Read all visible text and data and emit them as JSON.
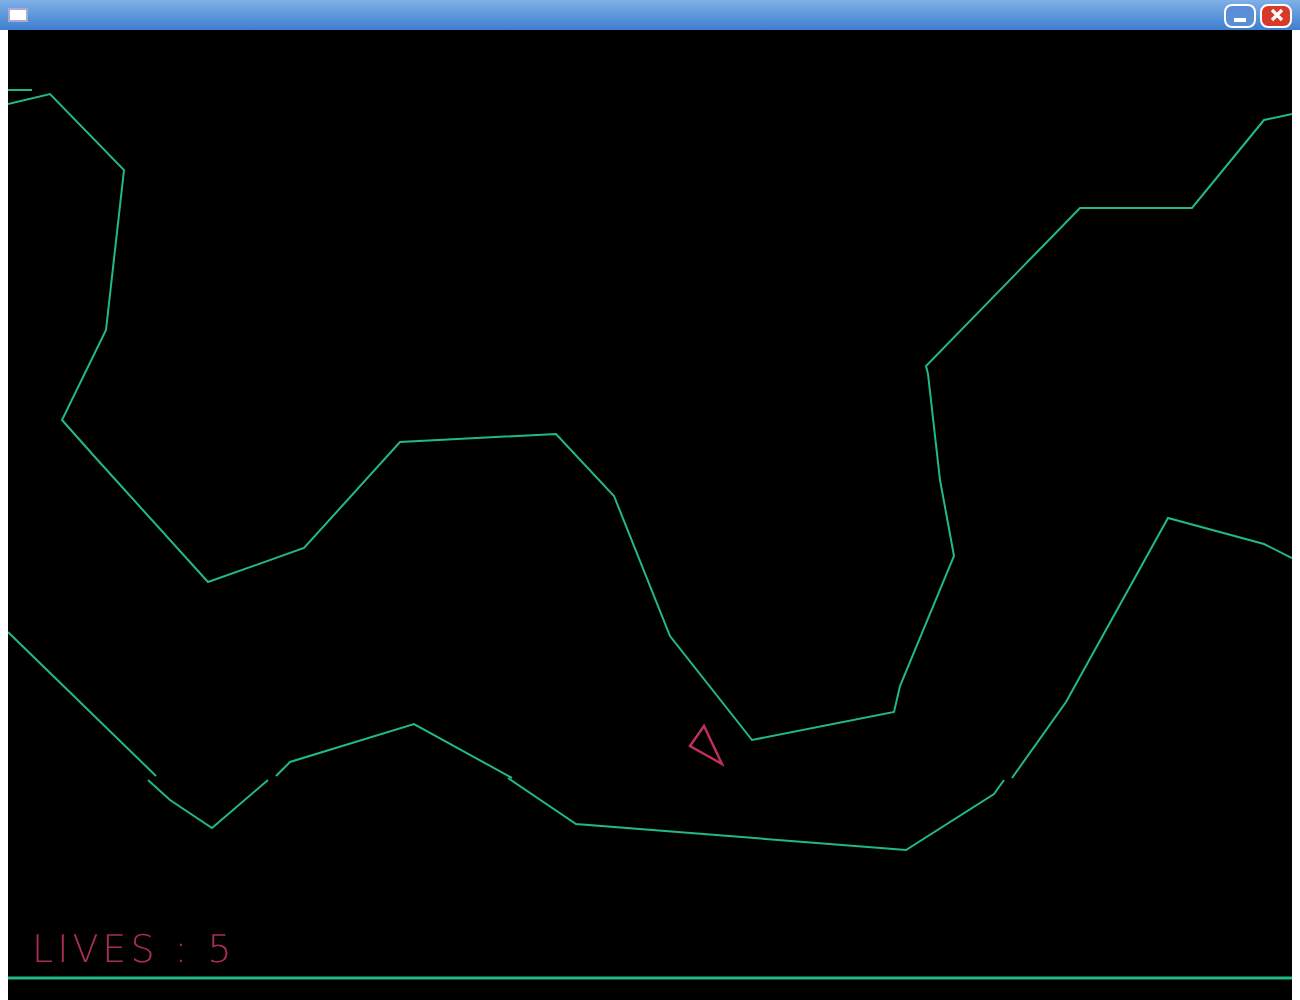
{
  "hud": {
    "lives": "LIVES : 5"
  }
}
